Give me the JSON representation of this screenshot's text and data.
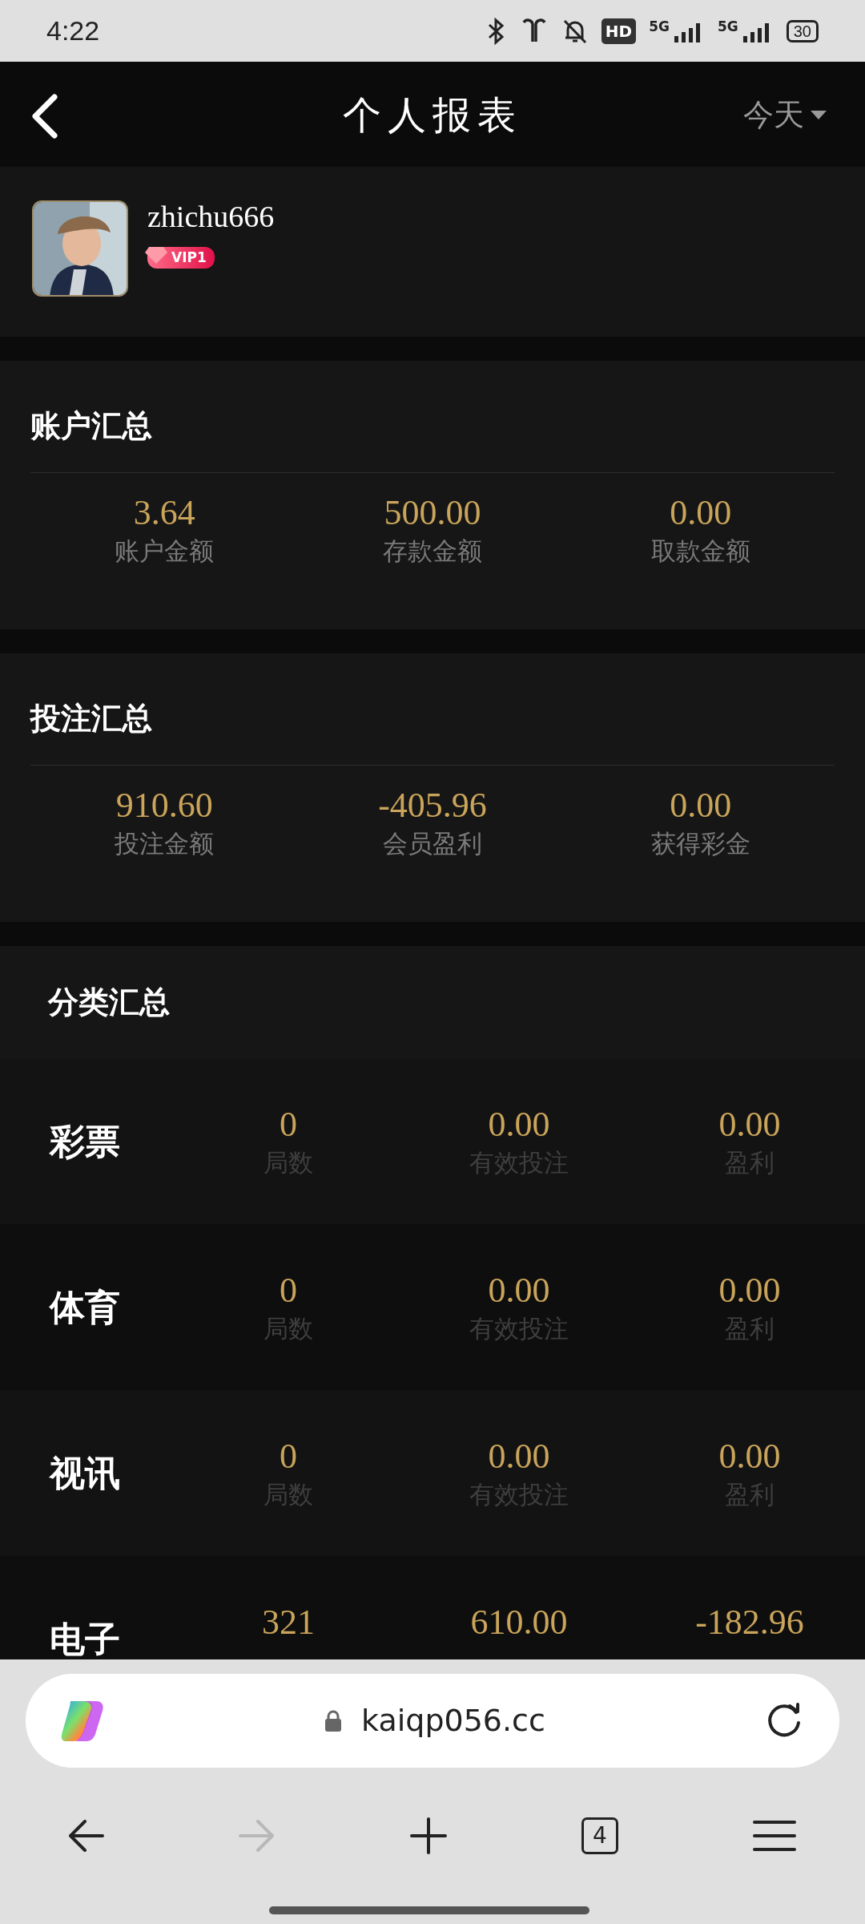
{
  "status_bar": {
    "time": "4:22",
    "hd_label": "HD",
    "network_labels": [
      "5G",
      "5G"
    ],
    "battery": "30"
  },
  "header": {
    "title": "个人报表",
    "filter": "今天"
  },
  "profile": {
    "username": "zhichu666",
    "vip": "VIP1"
  },
  "summaries": [
    {
      "title": "账户汇总",
      "items": [
        {
          "value": "3.64",
          "label": "账户金额"
        },
        {
          "value": "500.00",
          "label": "存款金额"
        },
        {
          "value": "0.00",
          "label": "取款金额"
        }
      ]
    },
    {
      "title": "投注汇总",
      "items": [
        {
          "value": "910.60",
          "label": "投注金额"
        },
        {
          "value": "-405.96",
          "label": "会员盈利"
        },
        {
          "value": "0.00",
          "label": "获得彩金"
        }
      ]
    }
  ],
  "category_summary": {
    "title": "分类汇总",
    "rows": [
      {
        "name": "彩票",
        "stats": [
          {
            "value": "0",
            "label": "局数"
          },
          {
            "value": "0.00",
            "label": "有效投注"
          },
          {
            "value": "0.00",
            "label": "盈利"
          }
        ]
      },
      {
        "name": "体育",
        "stats": [
          {
            "value": "0",
            "label": "局数"
          },
          {
            "value": "0.00",
            "label": "有效投注"
          },
          {
            "value": "0.00",
            "label": "盈利"
          }
        ]
      },
      {
        "name": "视讯",
        "stats": [
          {
            "value": "0",
            "label": "局数"
          },
          {
            "value": "0.00",
            "label": "有效投注"
          },
          {
            "value": "0.00",
            "label": "盈利"
          }
        ]
      },
      {
        "name": "电子",
        "stats": [
          {
            "value": "321"
          },
          {
            "value": "610.00"
          },
          {
            "value": "-182.96"
          }
        ]
      }
    ]
  },
  "browser": {
    "url": "kaiqp056.cc",
    "tab_count": "4",
    "forward_disabled": true
  }
}
